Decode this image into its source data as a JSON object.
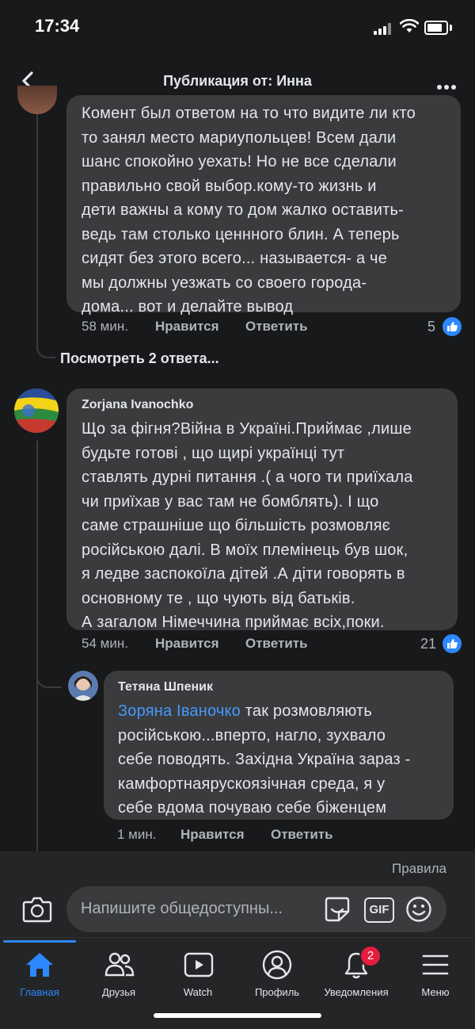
{
  "status_bar": {
    "time": "17:34"
  },
  "header": {
    "title": "Публикация от: Инна"
  },
  "comment_1": {
    "lines": [
      "Комент был ответом на то что видите ли кто",
      "то занял место мариупольцев! Всем дали",
      "шанс спокойно уехать! Но не все сделали",
      "правильно свой выбор.кому-то жизнь и",
      "дети важны а кому то дом жалко оставить-",
      "ведь там столько ценнного блин. А теперь",
      "сидят без этого всего... называется- а че",
      "мы должны уезжать со своего города-",
      "дома... вот и делайте вывод"
    ],
    "time": "58 мин.",
    "like_label": "Нравится",
    "reply_label": "Ответить",
    "like_count": "5"
  },
  "view_replies": "Посмотреть 2 ответа...",
  "comment_2": {
    "author": "Zorjana Ivanochko",
    "lines": [
      "Що за фігня?Війна в Україні.Приймає ,лише",
      "будьте готові , що щирі українці тут",
      "ставлять дурні питання .( а чого ти приїхала",
      "чи приїхав у вас там не бомблять). І що",
      "саме страшніше що більшість розмовляє",
      "російською далі. В моїх племінець був шок,",
      "я ледве заспокоїла дітей .А діти говорять в",
      "основному те , що чують від батьків.",
      "А загалом Німеччина приймає всіх,поки."
    ],
    "time": "54 мин.",
    "like_label": "Нравится",
    "reply_label": "Ответить",
    "like_count": "21"
  },
  "reply_1": {
    "author": "Тетяна Шпеник",
    "mention": "Зоряна Іваночко",
    "first_line_rest": " так розмовляють",
    "lines": [
      "російською...вперто, нагло, зухвало",
      "себе поводять. Західна Україна зараз -",
      "камфортнаярускоязічная среда, я у",
      "себе вдома почуваю себе біженцем"
    ],
    "time": "1 мин.",
    "like_label": "Нравится",
    "reply_label": "Ответить"
  },
  "compose": {
    "rules_label": "Правила",
    "placeholder": "Напишите общедоступны...",
    "gif_label": "GIF"
  },
  "tabs": [
    {
      "label": "Главная",
      "icon": "home-icon",
      "active": true
    },
    {
      "label": "Друзья",
      "icon": "friends-icon"
    },
    {
      "label": "Watch",
      "icon": "watch-icon"
    },
    {
      "label": "Профиль",
      "icon": "profile-icon"
    },
    {
      "label": "Уведомления",
      "icon": "bell-icon",
      "badge": "2"
    },
    {
      "label": "Меню",
      "icon": "menu-icon"
    }
  ],
  "colors": {
    "background": "#18191a",
    "bubble": "#3a3b3c",
    "accent": "#2d88ff",
    "mention": "#4599ff",
    "badge": "#e41e3f"
  }
}
